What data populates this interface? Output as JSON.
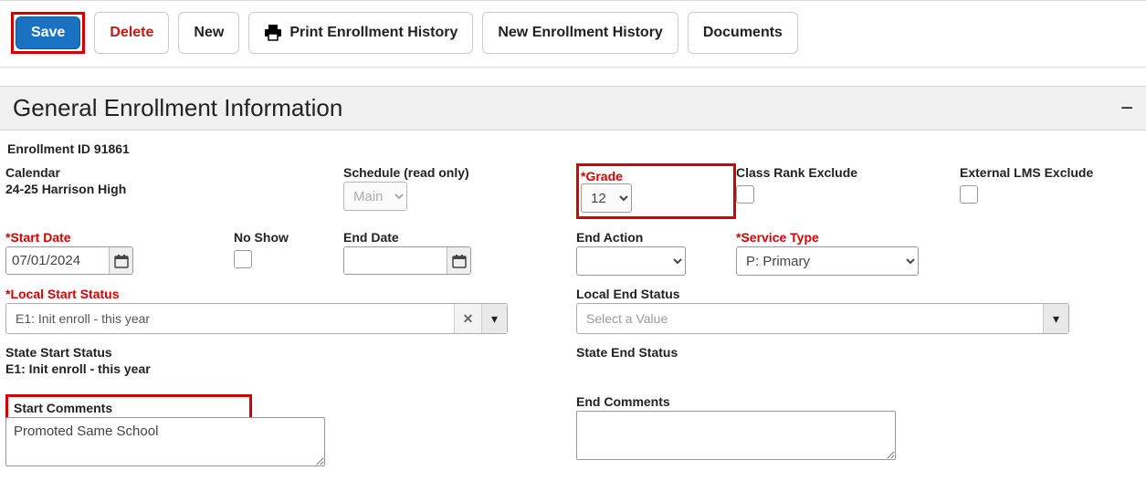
{
  "toolbar": {
    "save": "Save",
    "delete": "Delete",
    "new": "New",
    "print": "Print Enrollment History",
    "new_history": "New Enrollment History",
    "documents": "Documents"
  },
  "section": {
    "title": "General Enrollment Information"
  },
  "enrollment_id": {
    "label": "Enrollment ID",
    "value": "91861"
  },
  "calendar": {
    "label": "Calendar",
    "value": "24-25 Harrison High"
  },
  "schedule": {
    "label": "Schedule (read only)",
    "value": "Main"
  },
  "grade": {
    "label": "*Grade",
    "value": "12"
  },
  "class_rank_exclude": {
    "label": "Class Rank Exclude",
    "checked": false
  },
  "external_lms_exclude": {
    "label": "External LMS Exclude",
    "checked": false
  },
  "start_date": {
    "label": "*Start Date",
    "value": "07/01/2024"
  },
  "no_show": {
    "label": "No Show",
    "checked": false
  },
  "end_date": {
    "label": "End Date",
    "value": ""
  },
  "end_action": {
    "label": "End Action",
    "value": ""
  },
  "service_type": {
    "label": "*Service Type",
    "value": "P: Primary"
  },
  "local_start_status": {
    "label": "*Local Start Status",
    "value": "E1: Init enroll - this year"
  },
  "local_end_status": {
    "label": "Local End Status",
    "placeholder": "Select a Value",
    "value": ""
  },
  "state_start_status": {
    "label": "State Start Status",
    "value": "E1: Init enroll - this year"
  },
  "state_end_status": {
    "label": "State End Status",
    "value": ""
  },
  "start_comments": {
    "label": "Start Comments",
    "value": "Promoted Same School"
  },
  "end_comments": {
    "label": "End Comments",
    "value": ""
  }
}
